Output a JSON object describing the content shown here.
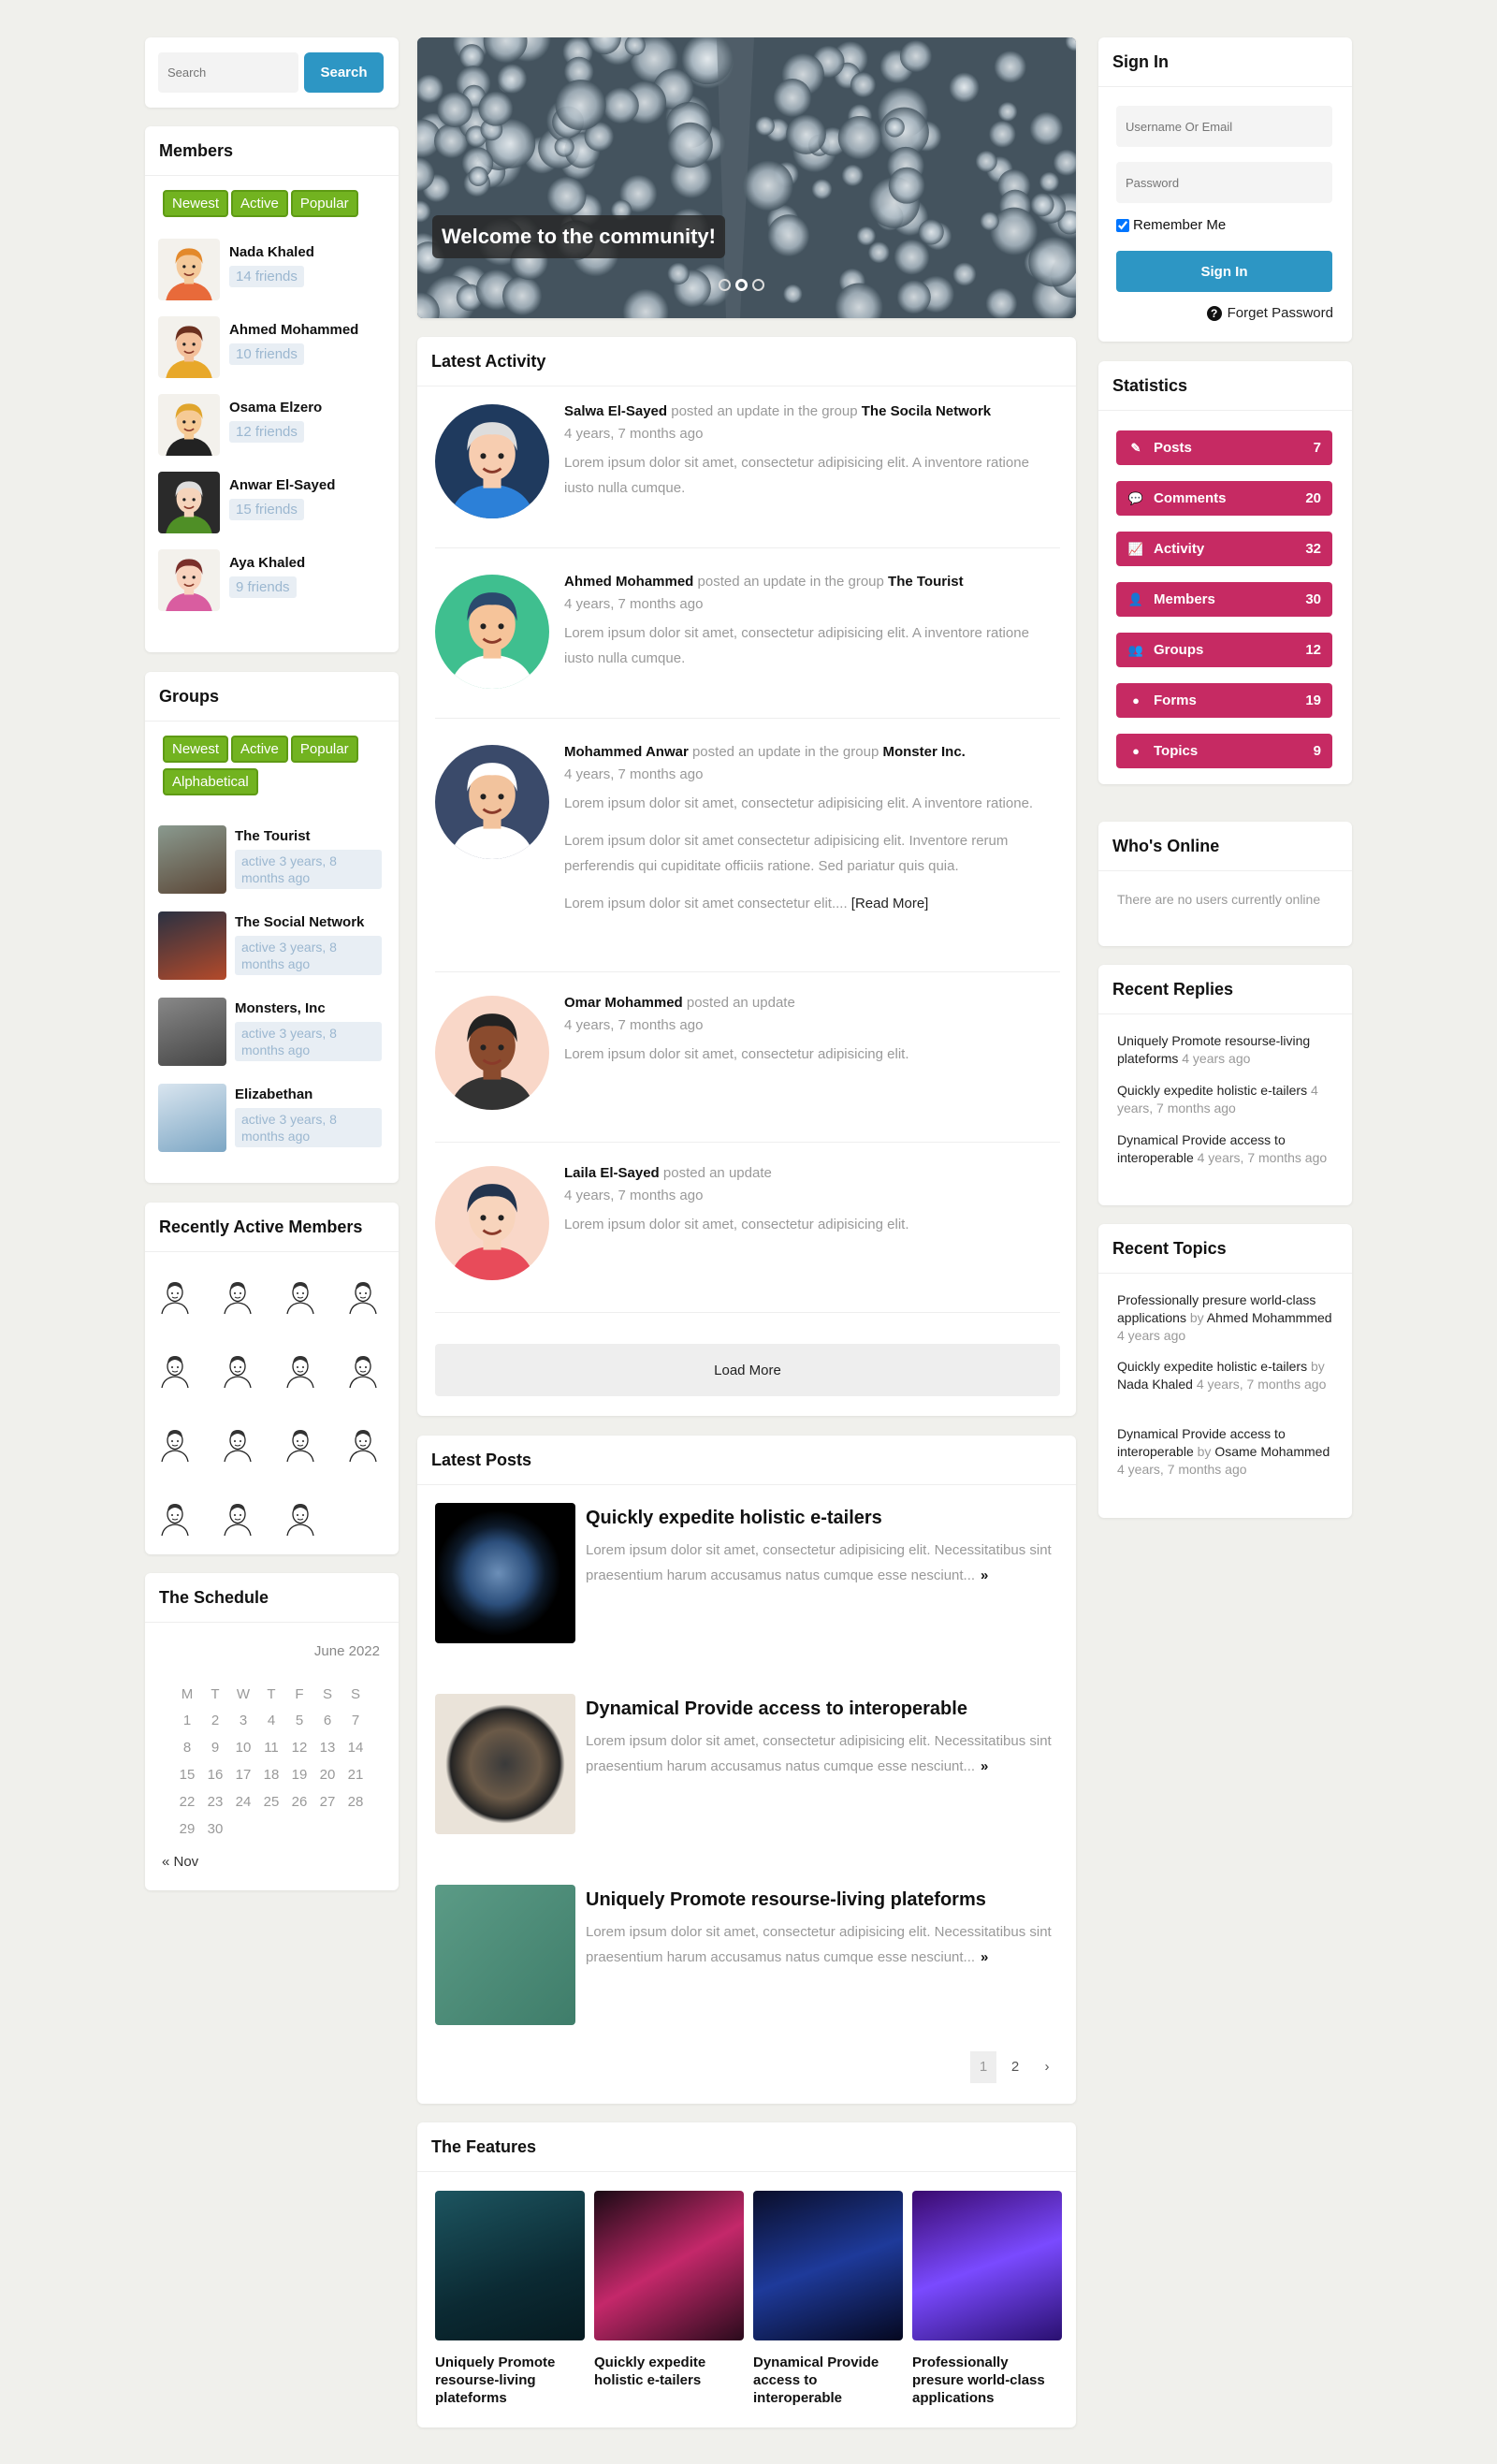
{
  "search": {
    "placeholder": "Search",
    "button": "Search"
  },
  "members": {
    "title": "Members",
    "filters": [
      "Newest",
      "Active",
      "Popular"
    ],
    "items": [
      {
        "name": "Nada Khaled",
        "friends": "14 friends"
      },
      {
        "name": "Ahmed Mohammed",
        "friends": "10 friends"
      },
      {
        "name": "Osama Elzero",
        "friends": "12 friends"
      },
      {
        "name": "Anwar El-Sayed",
        "friends": "15 friends"
      },
      {
        "name": "Aya Khaled",
        "friends": "9 friends"
      }
    ]
  },
  "groups": {
    "title": "Groups",
    "filters": [
      "Newest",
      "Active",
      "Popular",
      "Alphabetical"
    ],
    "items": [
      {
        "name": "The Tourist",
        "active": "active 3 years, 8 months ago"
      },
      {
        "name": "The Social Network",
        "active": "active 3 years, 8 months ago"
      },
      {
        "name": "Monsters, Inc",
        "active": "active 3 years, 8 months ago"
      },
      {
        "name": "Elizabethan",
        "active": "active 3 years, 8 months ago"
      }
    ]
  },
  "recent_members": {
    "title": "Recently Active Members"
  },
  "schedule": {
    "title": "The Schedule",
    "month": "June 2022",
    "days": [
      "M",
      "T",
      "W",
      "T",
      "F",
      "S",
      "S"
    ],
    "weeks": [
      [
        "1",
        "2",
        "3",
        "4",
        "5",
        "6",
        "7"
      ],
      [
        "8",
        "9",
        "10",
        "11",
        "12",
        "13",
        "14"
      ],
      [
        "15",
        "16",
        "17",
        "18",
        "19",
        "20",
        "21"
      ],
      [
        "22",
        "23",
        "24",
        "25",
        "26",
        "27",
        "28"
      ],
      [
        "29",
        "30",
        "",
        "",
        "",
        "",
        ""
      ]
    ],
    "prev": "« Nov"
  },
  "hero": {
    "caption": "Welcome to the community!"
  },
  "activity": {
    "title": "Latest Activity",
    "load_more": "Load More",
    "items": [
      {
        "user": "Salwa El-Sayed",
        "verb": "posted an update in the group",
        "group": "The Socila Network",
        "time": "4 years, 7 months ago",
        "text": "Lorem ipsum dolor sit amet, consectetur adipisicing elit. A inventore ratione iusto nulla cumque."
      },
      {
        "user": "Ahmed Mohammed",
        "verb": "posted an update in the group",
        "group": "The Tourist",
        "time": "4 years, 7 months ago",
        "text": "Lorem ipsum dolor sit amet, consectetur adipisicing elit. A inventore ratione iusto nulla cumque."
      },
      {
        "user": "Mohammed Anwar",
        "verb": "posted an update in the group",
        "group": "Monster Inc.",
        "time": "4 years, 7 months ago",
        "text": "Lorem ipsum dolor sit amet, consectetur adipisicing elit. A inventore ratione.",
        "text2": "Lorem ipsum dolor sit amet consectetur adipisicing elit. Inventore rerum perferendis qui cupiditate officiis ratione. Sed pariatur quis quia.",
        "text3": "Lorem ipsum dolor sit amet consectetur elit....",
        "read_more": "[Read More]"
      },
      {
        "user": "Omar Mohammed",
        "verb": "posted an update",
        "group": "",
        "time": "4 years, 7 months ago",
        "text": "Lorem ipsum dolor sit amet, consectetur adipisicing elit."
      },
      {
        "user": "Laila El-Sayed",
        "verb": "posted an update",
        "group": "",
        "time": "4 years, 7 months ago",
        "text": "Lorem ipsum dolor sit amet, consectetur adipisicing elit."
      }
    ]
  },
  "posts": {
    "title": "Latest Posts",
    "pages": [
      "1",
      "2"
    ],
    "items": [
      {
        "title": "Quickly expedite holistic e-tailers",
        "text": "Lorem ipsum dolor sit amet, consectetur adipisicing elit. Necessitatibus sint praesentium harum accusamus natus cumque esse nesciunt..."
      },
      {
        "title": "Dynamical Provide access to interoperable",
        "text": "Lorem ipsum dolor sit amet, consectetur adipisicing elit. Necessitatibus sint praesentium harum accusamus natus cumque esse nesciunt..."
      },
      {
        "title": "Uniquely Promote resourse-living plateforms",
        "text": "Lorem ipsum dolor sit amet, consectetur adipisicing elit. Necessitatibus sint praesentium harum accusamus natus cumque esse nesciunt..."
      }
    ]
  },
  "features": {
    "title": "The Features",
    "items": [
      "Uniquely Promote resourse-living plateforms",
      "Quickly expedite holistic e-tailers",
      "Dynamical Provide access to interoperable",
      "Professionally presure world-class applications"
    ]
  },
  "signin": {
    "title": "Sign In",
    "username_placeholder": "Username Or Email",
    "password_placeholder": "Password",
    "remember": "Remember Me",
    "button": "Sign In",
    "forget": "Forget Password"
  },
  "statistics": {
    "title": "Statistics",
    "items": [
      {
        "label": "Posts",
        "count": "7",
        "icon": "pencil-icon"
      },
      {
        "label": "Comments",
        "count": "20",
        "icon": "comments-icon"
      },
      {
        "label": "Activity",
        "count": "32",
        "icon": "chart-icon"
      },
      {
        "label": "Members",
        "count": "30",
        "icon": "user-icon"
      },
      {
        "label": "Groups",
        "count": "12",
        "icon": "users-icon"
      },
      {
        "label": "Forms",
        "count": "19",
        "icon": "comment-icon"
      },
      {
        "label": "Topics",
        "count": "9",
        "icon": "comment-dots-icon"
      }
    ]
  },
  "online": {
    "title": "Who's Online",
    "text": "There are no users currently online"
  },
  "replies": {
    "title": "Recent Replies",
    "items": [
      {
        "text": "Uniquely Promote resourse-living plateforms",
        "time": "4 years ago"
      },
      {
        "text": "Quickly expedite holistic e-tailers",
        "time": "4 years, 7 months ago"
      },
      {
        "text": "Dynamical Provide access to interoperable",
        "time": "4 years, 7 months ago"
      }
    ]
  },
  "topics": {
    "title": "Recent Topics",
    "items": [
      {
        "text": "Professionally presure world-class applications",
        "by": "by",
        "author": "Ahmed Mohammmed",
        "time": "4 years ago"
      },
      {
        "text": "Quickly expedite holistic e-tailers",
        "by": "by",
        "author": "Nada Khaled",
        "time": "4 years, 7 months ago"
      },
      {
        "text": "Dynamical Provide access to interoperable",
        "by": "by",
        "author": "Osame Mohammed",
        "time": "4 years, 7 months ago"
      }
    ]
  },
  "colors": {
    "accent": "#2d96c4",
    "green": "#72b320",
    "stat": "#c62a63"
  }
}
